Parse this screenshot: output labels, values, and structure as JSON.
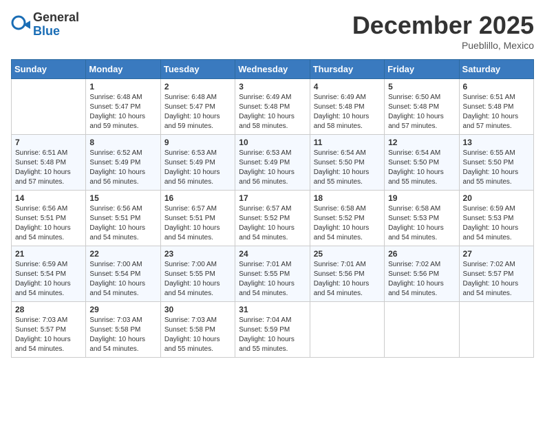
{
  "header": {
    "logo_general": "General",
    "logo_blue": "Blue",
    "month_title": "December 2025",
    "location": "Pueblillo, Mexico"
  },
  "days_of_week": [
    "Sunday",
    "Monday",
    "Tuesday",
    "Wednesday",
    "Thursday",
    "Friday",
    "Saturday"
  ],
  "weeks": [
    [
      {
        "day": "",
        "content": ""
      },
      {
        "day": "1",
        "content": "Sunrise: 6:48 AM\nSunset: 5:47 PM\nDaylight: 10 hours\nand 59 minutes."
      },
      {
        "day": "2",
        "content": "Sunrise: 6:48 AM\nSunset: 5:47 PM\nDaylight: 10 hours\nand 59 minutes."
      },
      {
        "day": "3",
        "content": "Sunrise: 6:49 AM\nSunset: 5:48 PM\nDaylight: 10 hours\nand 58 minutes."
      },
      {
        "day": "4",
        "content": "Sunrise: 6:49 AM\nSunset: 5:48 PM\nDaylight: 10 hours\nand 58 minutes."
      },
      {
        "day": "5",
        "content": "Sunrise: 6:50 AM\nSunset: 5:48 PM\nDaylight: 10 hours\nand 57 minutes."
      },
      {
        "day": "6",
        "content": "Sunrise: 6:51 AM\nSunset: 5:48 PM\nDaylight: 10 hours\nand 57 minutes."
      }
    ],
    [
      {
        "day": "7",
        "content": "Sunrise: 6:51 AM\nSunset: 5:48 PM\nDaylight: 10 hours\nand 57 minutes."
      },
      {
        "day": "8",
        "content": "Sunrise: 6:52 AM\nSunset: 5:49 PM\nDaylight: 10 hours\nand 56 minutes."
      },
      {
        "day": "9",
        "content": "Sunrise: 6:53 AM\nSunset: 5:49 PM\nDaylight: 10 hours\nand 56 minutes."
      },
      {
        "day": "10",
        "content": "Sunrise: 6:53 AM\nSunset: 5:49 PM\nDaylight: 10 hours\nand 56 minutes."
      },
      {
        "day": "11",
        "content": "Sunrise: 6:54 AM\nSunset: 5:50 PM\nDaylight: 10 hours\nand 55 minutes."
      },
      {
        "day": "12",
        "content": "Sunrise: 6:54 AM\nSunset: 5:50 PM\nDaylight: 10 hours\nand 55 minutes."
      },
      {
        "day": "13",
        "content": "Sunrise: 6:55 AM\nSunset: 5:50 PM\nDaylight: 10 hours\nand 55 minutes."
      }
    ],
    [
      {
        "day": "14",
        "content": "Sunrise: 6:56 AM\nSunset: 5:51 PM\nDaylight: 10 hours\nand 54 minutes."
      },
      {
        "day": "15",
        "content": "Sunrise: 6:56 AM\nSunset: 5:51 PM\nDaylight: 10 hours\nand 54 minutes."
      },
      {
        "day": "16",
        "content": "Sunrise: 6:57 AM\nSunset: 5:51 PM\nDaylight: 10 hours\nand 54 minutes."
      },
      {
        "day": "17",
        "content": "Sunrise: 6:57 AM\nSunset: 5:52 PM\nDaylight: 10 hours\nand 54 minutes."
      },
      {
        "day": "18",
        "content": "Sunrise: 6:58 AM\nSunset: 5:52 PM\nDaylight: 10 hours\nand 54 minutes."
      },
      {
        "day": "19",
        "content": "Sunrise: 6:58 AM\nSunset: 5:53 PM\nDaylight: 10 hours\nand 54 minutes."
      },
      {
        "day": "20",
        "content": "Sunrise: 6:59 AM\nSunset: 5:53 PM\nDaylight: 10 hours\nand 54 minutes."
      }
    ],
    [
      {
        "day": "21",
        "content": "Sunrise: 6:59 AM\nSunset: 5:54 PM\nDaylight: 10 hours\nand 54 minutes."
      },
      {
        "day": "22",
        "content": "Sunrise: 7:00 AM\nSunset: 5:54 PM\nDaylight: 10 hours\nand 54 minutes."
      },
      {
        "day": "23",
        "content": "Sunrise: 7:00 AM\nSunset: 5:55 PM\nDaylight: 10 hours\nand 54 minutes."
      },
      {
        "day": "24",
        "content": "Sunrise: 7:01 AM\nSunset: 5:55 PM\nDaylight: 10 hours\nand 54 minutes."
      },
      {
        "day": "25",
        "content": "Sunrise: 7:01 AM\nSunset: 5:56 PM\nDaylight: 10 hours\nand 54 minutes."
      },
      {
        "day": "26",
        "content": "Sunrise: 7:02 AM\nSunset: 5:56 PM\nDaylight: 10 hours\nand 54 minutes."
      },
      {
        "day": "27",
        "content": "Sunrise: 7:02 AM\nSunset: 5:57 PM\nDaylight: 10 hours\nand 54 minutes."
      }
    ],
    [
      {
        "day": "28",
        "content": "Sunrise: 7:03 AM\nSunset: 5:57 PM\nDaylight: 10 hours\nand 54 minutes."
      },
      {
        "day": "29",
        "content": "Sunrise: 7:03 AM\nSunset: 5:58 PM\nDaylight: 10 hours\nand 54 minutes."
      },
      {
        "day": "30",
        "content": "Sunrise: 7:03 AM\nSunset: 5:58 PM\nDaylight: 10 hours\nand 55 minutes."
      },
      {
        "day": "31",
        "content": "Sunrise: 7:04 AM\nSunset: 5:59 PM\nDaylight: 10 hours\nand 55 minutes."
      },
      {
        "day": "",
        "content": ""
      },
      {
        "day": "",
        "content": ""
      },
      {
        "day": "",
        "content": ""
      }
    ]
  ]
}
